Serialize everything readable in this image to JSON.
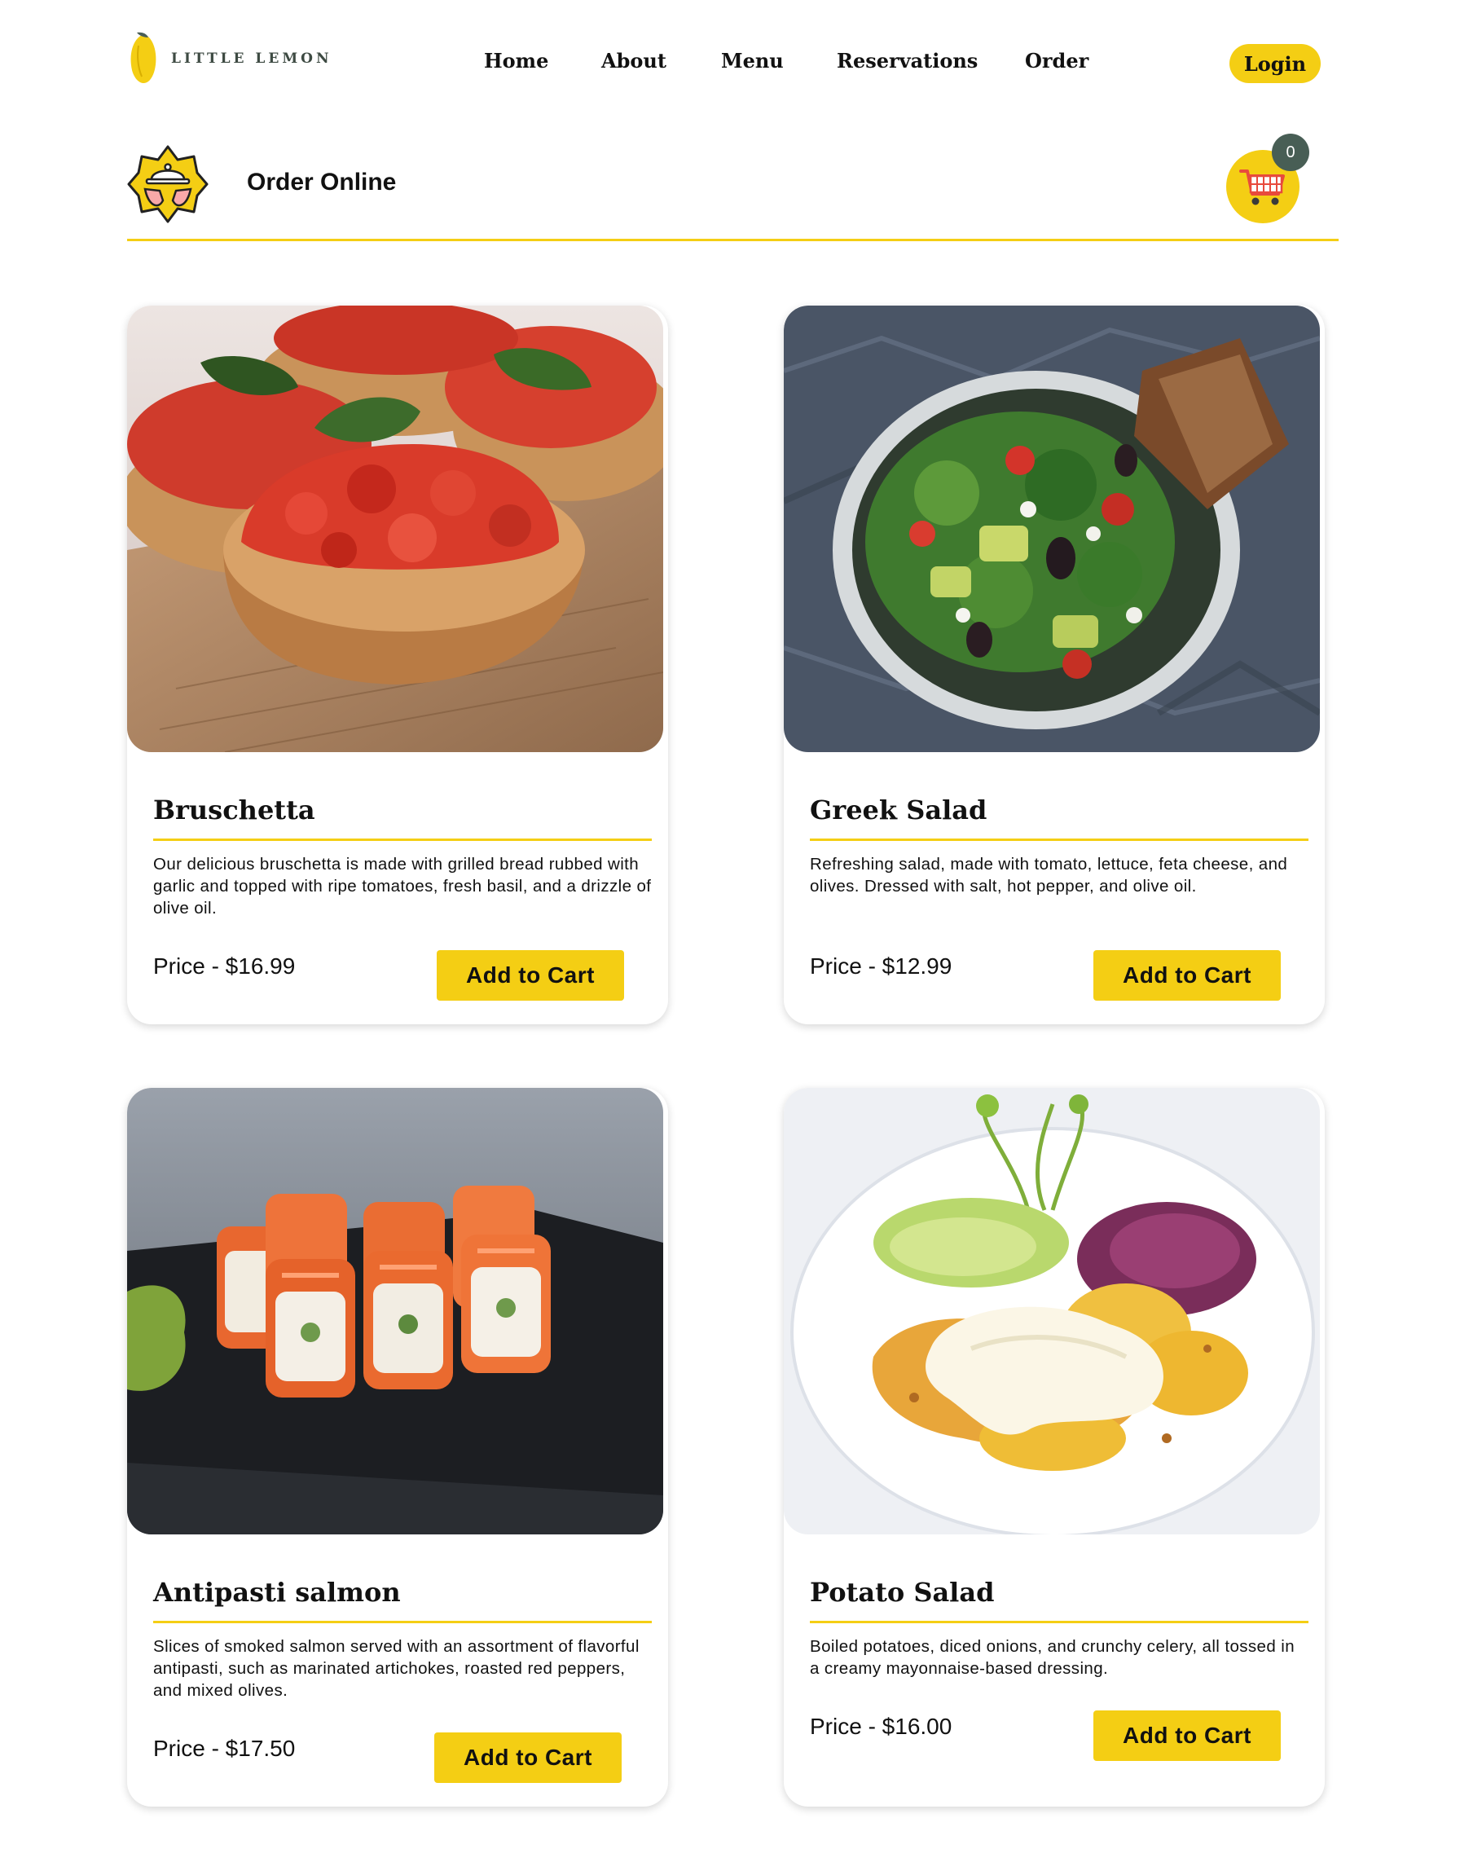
{
  "brand": {
    "name": "LITTLE LEMON",
    "accent": "#f4ce14",
    "dark_green": "#485e55"
  },
  "nav": {
    "links": [
      {
        "label": "Home"
      },
      {
        "label": "About"
      },
      {
        "label": "Menu"
      },
      {
        "label": "Reservations"
      },
      {
        "label": "Order"
      }
    ],
    "login_label": "Login"
  },
  "order_bar": {
    "title": "Order Online",
    "icon": "serving-cloche-icon",
    "cart_icon": "shopping-cart-icon",
    "cart_count": "0"
  },
  "items": [
    {
      "title": "Bruschetta",
      "description": "Our delicious bruschetta is made with grilled bread rubbed with garlic and topped with ripe tomatoes, fresh basil, and a drizzle of olive oil.",
      "price": "Price - $16.99",
      "button": "Add to Cart"
    },
    {
      "title": "Greek Salad",
      "description": "Refreshing salad, made with tomato, lettuce, feta cheese, and olives. Dressed with salt, hot pepper, and olive oil.",
      "price": "Price - $12.99",
      "button": "Add to Cart"
    },
    {
      "title": "Antipasti salmon",
      "description": "Slices of smoked salmon served with an assortment of flavorful antipasti, such as marinated artichokes, roasted red peppers, and mixed olives.",
      "price": "Price - $17.50",
      "button": "Add to Cart"
    },
    {
      "title": "Potato Salad",
      "description": "Boiled potatoes, diced onions, and crunchy celery, all tossed in a creamy mayonnaise-based dressing.",
      "price": "Price - $16.00",
      "button": "Add to Cart"
    }
  ]
}
